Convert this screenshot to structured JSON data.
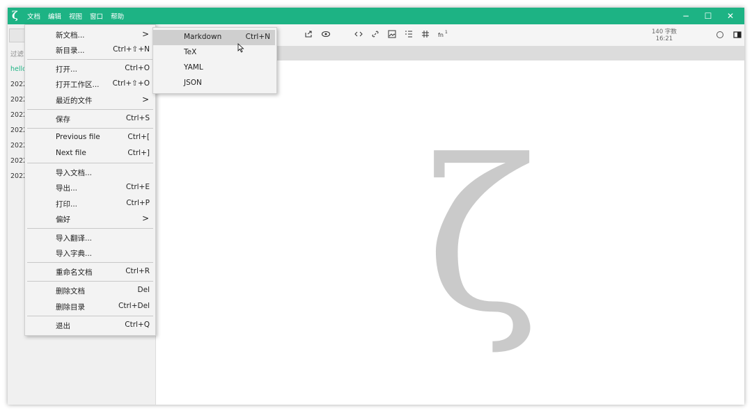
{
  "titlebar": {
    "logo": "ζ",
    "menus": [
      "文档",
      "编辑",
      "视图",
      "窗口",
      "帮助"
    ],
    "minimize": "−",
    "maximize": "☐",
    "close": "✕"
  },
  "toolbar": {
    "word_count": "140 字数",
    "time": "16:21",
    "icons": [
      "share-icon",
      "preview-icon",
      "code-icon",
      "link-icon",
      "image-icon",
      "list-icon",
      "hashtag-icon",
      "footnote-icon",
      "circle-icon",
      "split-view-icon"
    ]
  },
  "sidebar": {
    "filter_label": "过滤",
    "files": [
      "hello",
      "2022",
      "2022",
      "2022",
      "2022",
      "2022",
      "2022",
      "2022"
    ]
  },
  "file_menu": {
    "items": [
      {
        "label": "新文档...",
        "shortcut": "",
        "submenu": true
      },
      {
        "label": "新目录...",
        "shortcut": "Ctrl+⇧+N",
        "submenu": false
      },
      {
        "label": "打开...",
        "shortcut": "Ctrl+O",
        "submenu": false
      },
      {
        "label": "打开工作区...",
        "shortcut": "Ctrl+⇧+O",
        "submenu": false
      },
      {
        "label": "最近的文件",
        "shortcut": "",
        "submenu": true
      },
      {
        "label": "保存",
        "shortcut": "Ctrl+S",
        "submenu": false
      },
      {
        "label": "Previous file",
        "shortcut": "Ctrl+[",
        "submenu": false
      },
      {
        "label": "Next file",
        "shortcut": "Ctrl+]",
        "submenu": false
      },
      {
        "label": "导入文档...",
        "shortcut": "",
        "submenu": false
      },
      {
        "label": "导出...",
        "shortcut": "Ctrl+E",
        "submenu": false
      },
      {
        "label": "打印...",
        "shortcut": "Ctrl+P",
        "submenu": false
      },
      {
        "label": "偏好",
        "shortcut": "",
        "submenu": true
      },
      {
        "label": "导入翻译...",
        "shortcut": "",
        "submenu": false
      },
      {
        "label": "导入字典...",
        "shortcut": "",
        "submenu": false
      },
      {
        "label": "重命名文档",
        "shortcut": "Ctrl+R",
        "submenu": false
      },
      {
        "label": "删除文档",
        "shortcut": "Del",
        "submenu": false
      },
      {
        "label": "删除目录",
        "shortcut": "Ctrl+Del",
        "submenu": false
      },
      {
        "label": "退出",
        "shortcut": "Ctrl+Q",
        "submenu": false
      }
    ],
    "arrow": ">"
  },
  "new_submenu": {
    "items": [
      {
        "label": "Markdown",
        "shortcut": "Ctrl+N",
        "highlighted": true
      },
      {
        "label": "TeX",
        "shortcut": "",
        "highlighted": false
      },
      {
        "label": "YAML",
        "shortcut": "",
        "highlighted": false
      },
      {
        "label": "JSON",
        "shortcut": "",
        "highlighted": false
      }
    ]
  },
  "editor": {
    "watermark": "ζ"
  },
  "colors": {
    "accent": "#1db384",
    "menu_bg": "#f3f3f3",
    "highlight": "#cfcfcf",
    "watermark": "#cacaca"
  }
}
